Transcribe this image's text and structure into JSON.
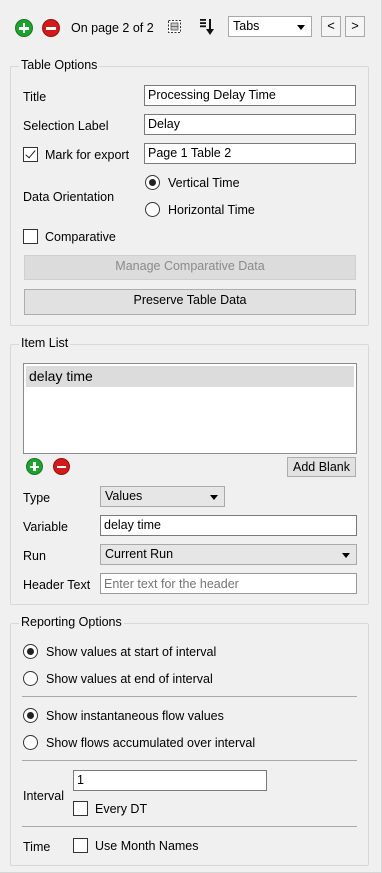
{
  "toolbar": {
    "page_label": "On page 2 of 2",
    "view_select": "Tabs",
    "prev_label": "<",
    "next_label": ">"
  },
  "table_options": {
    "legend": "Table Options",
    "title_label": "Title",
    "title_value": "Processing Delay Time",
    "selection_label_label": "Selection Label",
    "selection_label_value": "Delay",
    "mark_for_export_label": "Mark for export",
    "mark_for_export_checked": true,
    "export_name_value": "Page 1 Table 2",
    "data_orientation_label": "Data Orientation",
    "vertical_time_label": "Vertical Time",
    "horizontal_time_label": "Horizontal Time",
    "orientation_selected": "Vertical Time",
    "comparative_label": "Comparative",
    "comparative_checked": false,
    "manage_comparative_label": "Manage Comparative Data",
    "preserve_table_label": "Preserve Table Data"
  },
  "item_list": {
    "legend": "Item List",
    "items": [
      "delay time"
    ],
    "selected_index": 0,
    "add_blank_label": "Add Blank",
    "type_label": "Type",
    "type_value": "Values",
    "variable_label": "Variable",
    "variable_value": "delay time",
    "run_label": "Run",
    "run_value": "Current Run",
    "header_text_label": "Header Text",
    "header_text_placeholder": "Enter text for the header"
  },
  "reporting_options": {
    "legend": "Reporting Options",
    "start_label": "Show values at start of interval",
    "end_label": "Show values at end of interval",
    "interval_value_selected": "Show values at start of interval",
    "instant_label": "Show instantaneous flow values",
    "accum_label": "Show flows accumulated over interval",
    "flow_selected": "Show instantaneous flow values",
    "interval_label": "Interval",
    "interval_value": "1",
    "every_dt_label": "Every DT",
    "every_dt_checked": false,
    "time_label": "Time",
    "month_names_label": "Use Month Names",
    "month_names_checked": false
  }
}
